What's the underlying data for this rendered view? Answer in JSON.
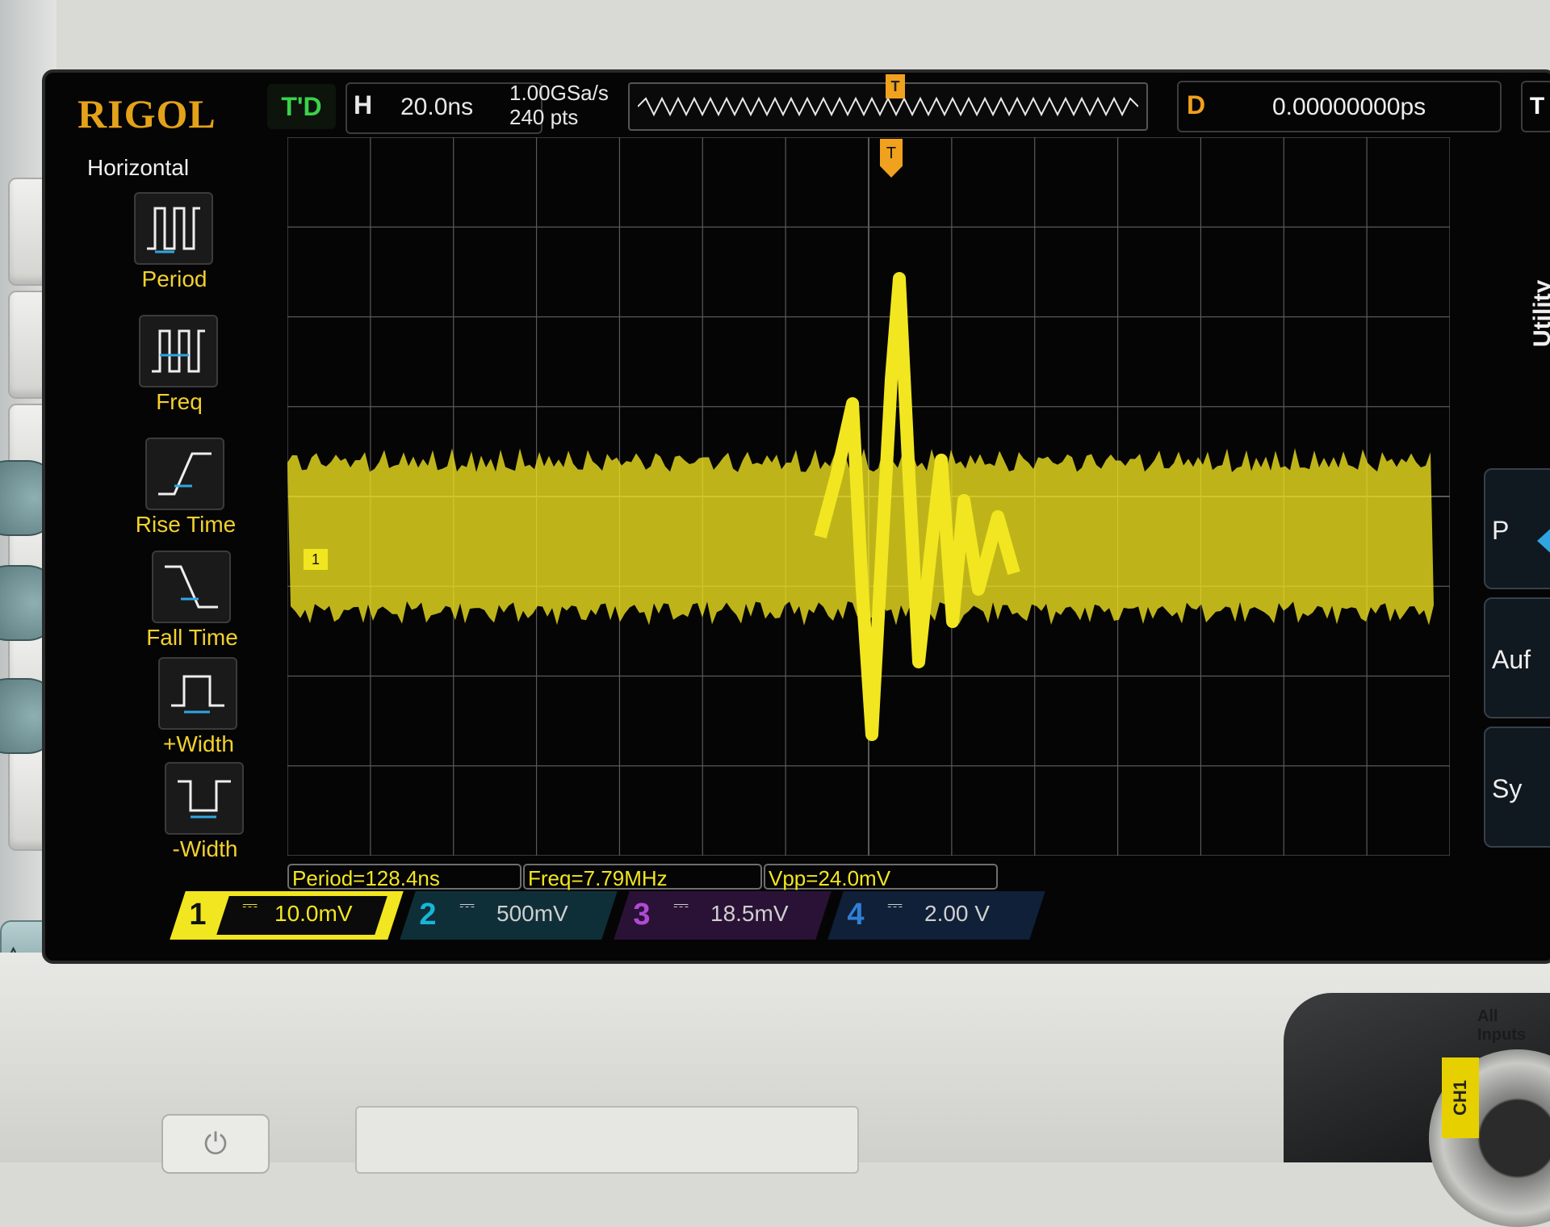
{
  "brand": "RIGOL",
  "run_state": "T'D",
  "horizontal": {
    "letter": "H",
    "timebase": "20.0ns"
  },
  "acquisition": {
    "sample_rate": "1.00GSa/s",
    "points": "240 pts"
  },
  "delay": {
    "letter": "D",
    "value": "0.00000000ps"
  },
  "trigger_box": {
    "letter": "T"
  },
  "markers": {
    "trigger_top": "T",
    "trigger_level": "T",
    "ch1_ref": "1"
  },
  "left_menu": {
    "title": "Horizontal",
    "items": [
      {
        "label": "Period",
        "icon": "period-icon"
      },
      {
        "label": "Freq",
        "icon": "freq-icon"
      },
      {
        "label": "Rise Time",
        "icon": "rise-time-icon"
      },
      {
        "label": "Fall Time",
        "icon": "fall-time-icon"
      },
      {
        "label": "+Width",
        "icon": "pos-width-icon"
      },
      {
        "label": "-Width",
        "icon": "neg-width-icon"
      }
    ]
  },
  "right_menu": {
    "title": "Utility",
    "items": [
      "P",
      "Auf",
      "Sy"
    ]
  },
  "measurements": {
    "period": "Period=128.4ns",
    "freq": "Freq=7.79MHz",
    "vpp": "Vpp=24.0mV"
  },
  "channels": [
    {
      "num": "1",
      "coupling": "⎓",
      "scale": "10.0mV",
      "color": "#f2e620"
    },
    {
      "num": "2",
      "coupling": "⎓",
      "scale": "500mV",
      "color": "#16b6d6"
    },
    {
      "num": "3",
      "coupling": "⎓",
      "scale": "18.5mV",
      "color": "#b04ad6"
    },
    {
      "num": "4",
      "coupling": "⎓",
      "scale": "2.00 V",
      "color": "#2f7fd6"
    }
  ],
  "hardware": {
    "inputs_label": "All Inputs",
    "ch1_label": "CH1",
    "power_symbol": "⏻"
  },
  "colors": {
    "trace": "#f2e620",
    "trigger": "#f0a11d",
    "grid": "#5a5a5a"
  }
}
